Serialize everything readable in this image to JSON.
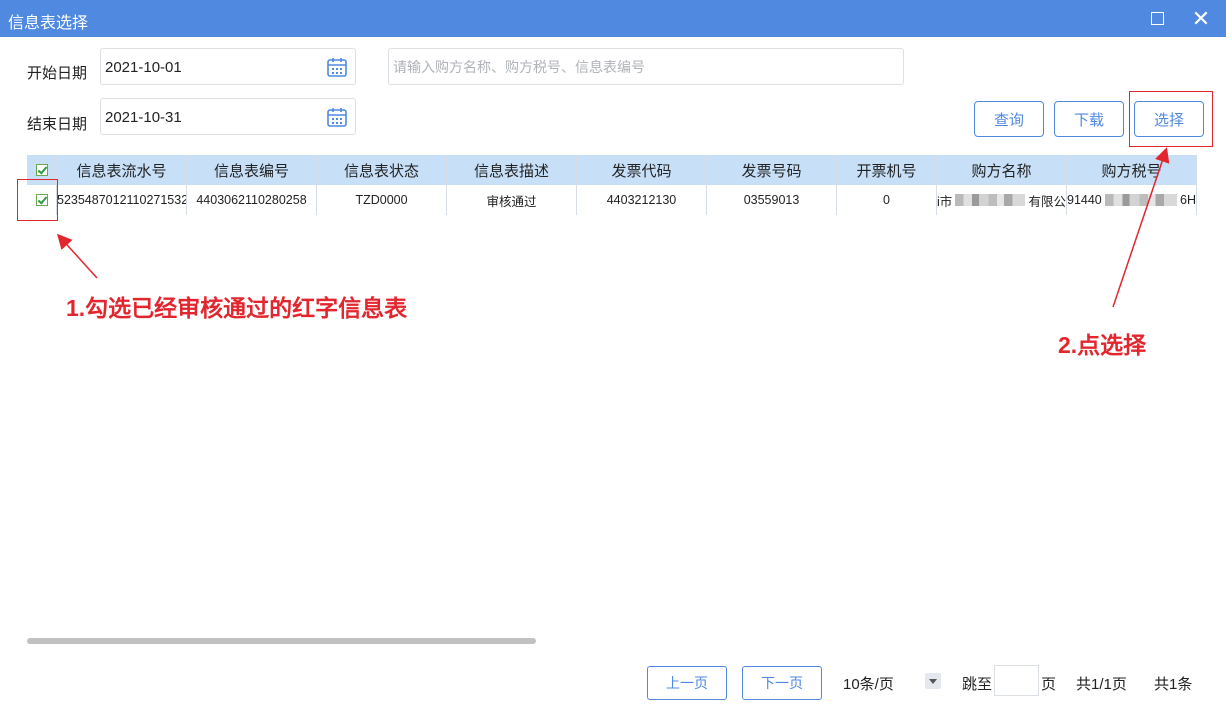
{
  "window": {
    "title": "信息表选择"
  },
  "filters": {
    "start_label": "开始日期",
    "start_value": "2021-10-01",
    "end_label": "结束日期",
    "end_value": "2021-10-31",
    "search_placeholder": "请输入购方名称、购方税号、信息表编号"
  },
  "buttons": {
    "query": "查询",
    "download": "下载",
    "select": "选择"
  },
  "table": {
    "columns": [
      "信息表流水号",
      "信息表编号",
      "信息表状态",
      "信息表描述",
      "发票代码",
      "发票号码",
      "开票机号",
      "购方名称",
      "购方税号"
    ],
    "rows": [
      {
        "checked": true,
        "serial": "5235487012110271532",
        "number": "4403062110280258",
        "status": "TZD0000",
        "desc": "审核通过",
        "invoice_code": "4403212130",
        "invoice_no": "03559013",
        "machine_no": "0",
        "buyer_name_prefix": "i市",
        "buyer_name_suffix": "有限公",
        "buyer_tax_prefix": "91440",
        "buyer_tax_suffix": "6H"
      }
    ]
  },
  "pagination": {
    "prev": "上一页",
    "next": "下一页",
    "page_size": "10条/页",
    "jump_label": "跳至",
    "page_unit": "页",
    "total_pages": "共1/1页",
    "total_records": "共1条"
  },
  "annotations": {
    "step1": "1.勾选已经审核通过的红字信息表",
    "step2": "2.点选择",
    "color": "#e3262e"
  },
  "colors": {
    "titlebar": "#4f8ae0",
    "header_bg": "#c7e0f8",
    "accent": "#4f8ae0"
  }
}
